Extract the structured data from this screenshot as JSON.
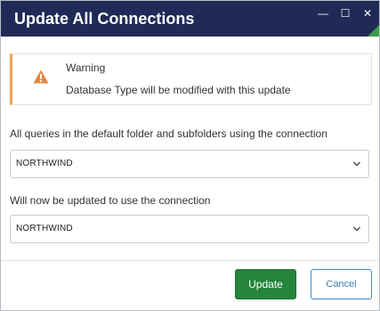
{
  "window": {
    "title": "Update All Connections",
    "minimize_glyph": "—",
    "maximize_glyph": "☐",
    "close_glyph": "✕"
  },
  "warning": {
    "title": "Warning",
    "message": "Database Type will be modified with this update",
    "accent_color": "#f0a058",
    "icon_color": "#e8873d"
  },
  "source": {
    "label": "All queries in the default folder and subfolders using the connection",
    "selected": "NORTHWIND"
  },
  "target": {
    "label": "Will now be updated to use the connection",
    "selected": "NORTHWIND"
  },
  "buttons": {
    "update_label": "Update",
    "cancel_label": "Cancel"
  },
  "colors": {
    "titlebar": "#1f2a56",
    "update_button": "#23863b",
    "cancel_border": "#3e89c7"
  }
}
